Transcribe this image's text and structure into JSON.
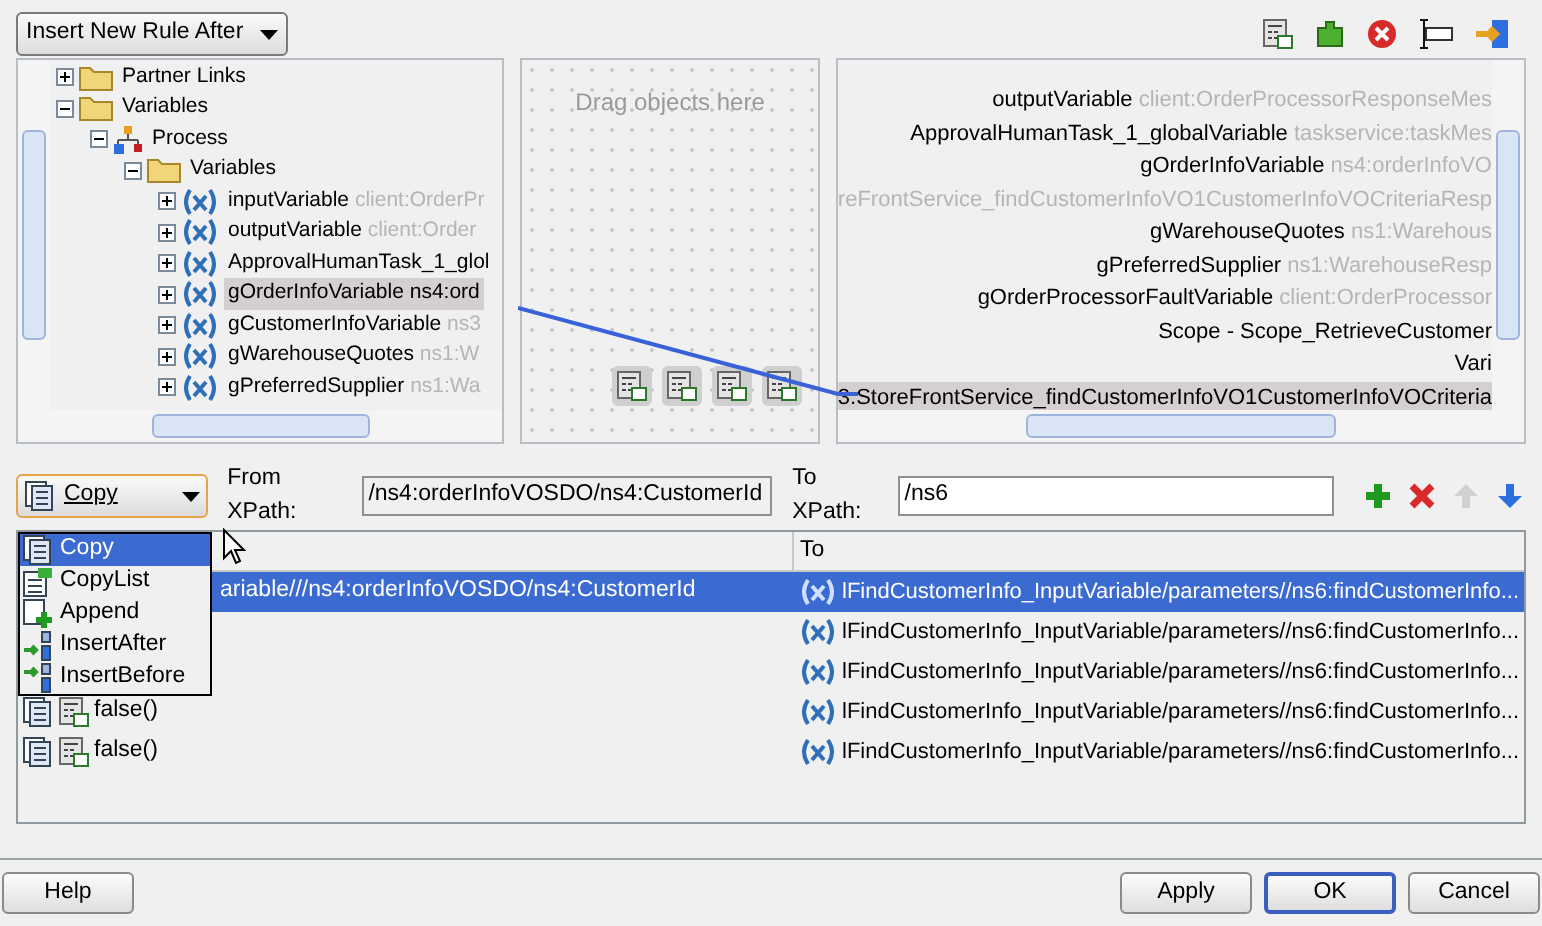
{
  "rule_dropdown": {
    "value": "Insert New Rule After"
  },
  "source_tree": [
    {
      "label": "Partner Links",
      "kind": "folder",
      "expanded": false,
      "selected": false
    },
    {
      "label": "Variables",
      "kind": "folder",
      "expanded": true,
      "selected": false,
      "children": [
        {
          "label": "Process",
          "kind": "process",
          "expanded": true,
          "selected": false,
          "children": [
            {
              "label": "Variables",
              "kind": "folder",
              "expanded": true,
              "selected": false,
              "children": [
                {
                  "label": "inputVariable",
                  "type": "client:OrderPr",
                  "kind": "variable",
                  "expanded": false,
                  "selected": false
                },
                {
                  "label": "outputVariable",
                  "type": "client:Order",
                  "kind": "variable",
                  "expanded": false,
                  "selected": false
                },
                {
                  "label": "ApprovalHumanTask_1_glol",
                  "kind": "variable",
                  "expanded": false,
                  "selected": false
                },
                {
                  "label": "gOrderInfoVariable ns4:ord",
                  "kind": "variable",
                  "expanded": false,
                  "selected": true
                },
                {
                  "label": "gCustomerInfoVariable",
                  "type": "ns3",
                  "kind": "variable",
                  "expanded": false,
                  "selected": false
                },
                {
                  "label": "gWarehouseQuotes",
                  "type": "ns1:W",
                  "kind": "variable",
                  "expanded": false,
                  "selected": false
                },
                {
                  "label": "gPreferredSupplier",
                  "type": "ns1:Wa",
                  "kind": "variable",
                  "expanded": false,
                  "selected": false
                }
              ]
            }
          ]
        }
      ]
    }
  ],
  "drop_area": {
    "placeholder": "Drag objects here"
  },
  "target_tree": [
    {
      "label": "outputVariable",
      "type": "client:OrderProcessorResponseMes",
      "selected": false
    },
    {
      "label": "ApprovalHumanTask_1_globalVariable",
      "type": "taskservice:taskMes",
      "selected": false
    },
    {
      "label": "gOrderInfoVariable",
      "type": "ns4:orderInfoVO",
      "selected": false
    },
    {
      "type": "reFrontService_findCustomerInfoVO1CustomerInfoVOCriteriaResp",
      "selected": false
    },
    {
      "label": "gWarehouseQuotes",
      "type": "ns1:Warehous",
      "selected": false
    },
    {
      "label": "gPreferredSupplier",
      "type": "ns1:WarehouseResp",
      "selected": false
    },
    {
      "label": "gOrderProcessorFaultVariable",
      "type": "client:OrderProcessor",
      "selected": false
    },
    {
      "label": "Scope - Scope_RetrieveCustomer",
      "selected": false
    },
    {
      "label": "Vari",
      "selected": false
    },
    {
      "label": "3:StoreFrontService_findCustomerInfoVO1CustomerInfoVOCriteria",
      "selected": true
    }
  ],
  "operation": {
    "value": "Copy",
    "menu": [
      {
        "label": "Copy",
        "kind": "copy",
        "selected": true
      },
      {
        "label": "CopyList",
        "kind": "copylist",
        "selected": false
      },
      {
        "label": "Append",
        "kind": "append",
        "selected": false
      },
      {
        "label": "InsertAfter",
        "kind": "insertafter",
        "selected": false
      },
      {
        "label": "InsertBefore",
        "kind": "insertbefore",
        "selected": false
      }
    ]
  },
  "from_xpath": {
    "label": "From XPath:",
    "value": "/ns4:orderInfoVOSDO/ns4:CustomerId"
  },
  "to_xpath": {
    "label": "To XPath:",
    "value": "/ns6"
  },
  "table": {
    "column_2": "To",
    "rows": [
      {
        "selected": true,
        "from": "ariable///ns4:orderInfoVOSDO/ns4:CustomerId",
        "kind": "variable",
        "to": "lFindCustomerInfo_InputVariable/parameters//ns6:findCustomerInfo..."
      },
      {
        "selected": false,
        "to": "lFindCustomerInfo_InputVariable/parameters//ns6:findCustomerInfo..."
      },
      {
        "selected": false,
        "to": "lFindCustomerInfo_InputVariable/parameters//ns6:findCustomerInfo..."
      },
      {
        "selected": false,
        "from": "false()",
        "kind": "function",
        "to": "lFindCustomerInfo_InputVariable/parameters//ns6:findCustomerInfo..."
      },
      {
        "selected": false,
        "from": "false()",
        "kind": "function",
        "to": "lFindCustomerInfo_InputVariable/parameters//ns6:findCustomerInfo..."
      }
    ]
  },
  "buttons": [
    {
      "label": "Help",
      "default": false
    },
    {
      "label": "Apply",
      "default": false
    },
    {
      "label": "OK",
      "default": true
    },
    {
      "label": "Cancel",
      "default": false
    }
  ]
}
